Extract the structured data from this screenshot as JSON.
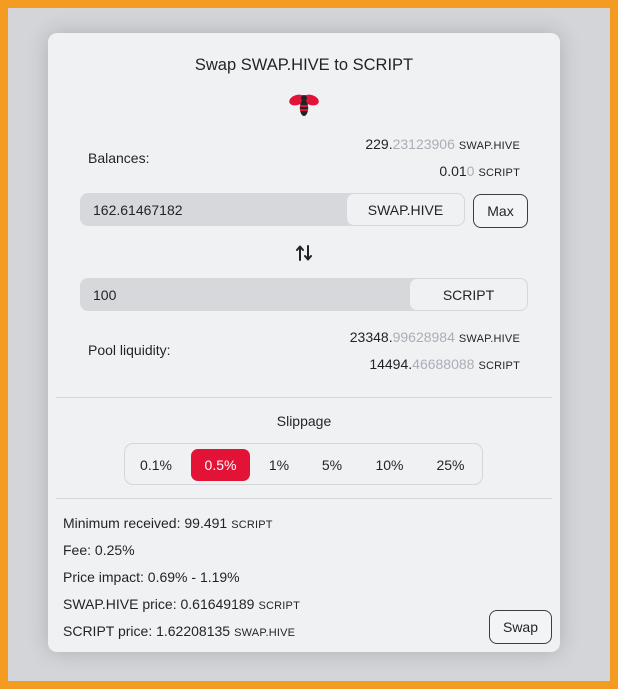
{
  "title": "Swap SWAP.HIVE to SCRIPT",
  "logo_icon": "hive-bee-icon",
  "balances": {
    "label": "Balances:",
    "from": {
      "main": "229.",
      "faded": "23123906",
      "symbol": "SWAP.HIVE"
    },
    "to": {
      "main": "0.01",
      "faded": "0",
      "symbol": "SCRIPT"
    }
  },
  "from_input": {
    "value": "162.61467182",
    "token": "SWAP.HIVE"
  },
  "max_label": "Max",
  "swap_direction_icon": "swap-arrows-icon",
  "to_input": {
    "value": "100",
    "token": "SCRIPT"
  },
  "pool": {
    "label": "Pool liquidity:",
    "a": {
      "main": "23348.",
      "faded": "99628984",
      "symbol": "SWAP.HIVE"
    },
    "b": {
      "main": "14494.",
      "faded": "46688088",
      "symbol": "SCRIPT"
    }
  },
  "slippage": {
    "label": "Slippage",
    "options": [
      "0.1%",
      "0.5%",
      "1%",
      "5%",
      "10%",
      "25%"
    ],
    "selected": "0.5%"
  },
  "details": {
    "min_received": {
      "text": "Minimum received: 99.491",
      "symbol": "SCRIPT"
    },
    "fee": "Fee: 0.25%",
    "price_impact": "Price impact: 0.69% - 1.19%",
    "from_price": {
      "text": "SWAP.HIVE price: 0.61649189",
      "symbol": "SCRIPT"
    },
    "to_price": {
      "text": "SCRIPT price: 1.62208135",
      "symbol": "SWAP.HIVE"
    }
  },
  "swap_label": "Swap",
  "colors": {
    "accent": "#e31337",
    "page_border": "#f39c21"
  }
}
